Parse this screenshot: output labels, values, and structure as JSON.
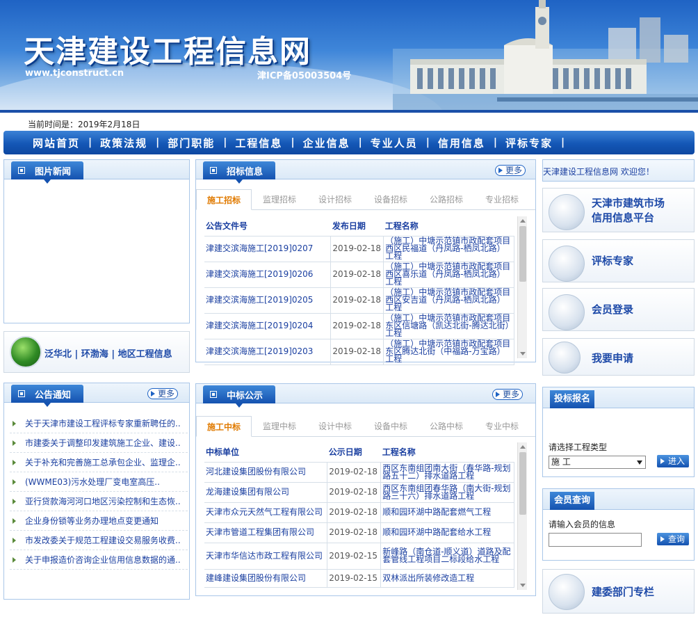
{
  "banner": {
    "title": "天津建设工程信息网",
    "url": "www.tjconstruct.cn",
    "icp": "津ICP备05003504号"
  },
  "date_line": "当前时间是：2019年2月18日",
  "nav": [
    "网站首页",
    "政策法规",
    "部门职能",
    "工程信息",
    "企业信息",
    "专业人员",
    "信用信息",
    "评标专家"
  ],
  "nav_sep": "|",
  "photo_news": {
    "title": "图片新闻"
  },
  "region_banner": "泛华北 | 环渤海 | 地区工程信息",
  "notices": {
    "title": "公告通知",
    "more": "更多",
    "items": [
      "关于天津市建设工程评标专家重新聘任的..",
      "市建委关于调整印发建筑施工企业、建设..",
      "关于补充和完善施工总承包企业、监理企..",
      "(WWME03)污水处理厂变电室高压..",
      "亚行贷款海河河口地区污染控制和生态恢..",
      "企业身份锁等业务办理地点变更通知",
      "市发改委关于规范工程建设交易服务收费..",
      "关于申报造价咨询企业信用信息数据的通.."
    ]
  },
  "bidding": {
    "title": "招标信息",
    "more": "更多",
    "tabs": [
      "施工招标",
      "监理招标",
      "设计招标",
      "设备招标",
      "公路招标",
      "专业招标"
    ],
    "headers": [
      "公告文件号",
      "发布日期",
      "工程名称"
    ],
    "rows": [
      [
        "津建交滨海施工[2019]0207",
        "2019-02-18",
        "（施工）中塘示范镇市政配套项目西区民福道（丹凤路-栖凤北路）工程"
      ],
      [
        "津建交滨海施工[2019]0206",
        "2019-02-18",
        "（施工）中塘示范镇市政配套项目西区喜乐道（丹凤路-栖凤北路）工程"
      ],
      [
        "津建交滨海施工[2019]0205",
        "2019-02-18",
        "（施工）中塘示范镇市政配套项目西区安吉道（丹凤路-栖凤北路）工程"
      ],
      [
        "津建交滨海施工[2019]0204",
        "2019-02-18",
        "（施工）中塘示范镇市政配套项目东区信塘路（凯达北街-腾达北街）工程"
      ],
      [
        "津建交滨海施工[2019]0203",
        "2019-02-18",
        "（施工）中塘示范镇市政配套项目东区腾达北街（中福路-万宝路）工程"
      ]
    ]
  },
  "award": {
    "title": "中标公示",
    "more": "更多",
    "tabs": [
      "施工中标",
      "监理中标",
      "设计中标",
      "设备中标",
      "公路中标",
      "专业中标"
    ],
    "headers": [
      "中标单位",
      "公示日期",
      "工程名称"
    ],
    "rows": [
      [
        "河北建设集团股份有限公司",
        "2019-02-18",
        "西区东南组团南大街（春华路-规划路五十二）排水道路工程"
      ],
      [
        "龙海建设集团有限公司",
        "2019-02-18",
        "西区东南组团春华路（南大街-规划路三十六）排水道路工程"
      ],
      [
        "天津市众元天然气工程有限公司",
        "2019-02-18",
        "顺和园环湖中路配套燃气工程"
      ],
      [
        "天津市管道工程集团有限公司",
        "2019-02-18",
        "顺和园环湖中路配套给水工程"
      ],
      [
        "天津市华信达市政工程有限公司",
        "2019-02-15",
        "新峰路（南仓道-顺义道）道路及配套管线工程项目二标段给水工程"
      ],
      [
        "建峰建设集团股份有限公司",
        "2019-02-15",
        "双林派出所装修改造工程"
      ]
    ]
  },
  "welcome": "天津建设工程信息网 欢迎您！",
  "tiles": [
    {
      "label": "天津市建筑市场\n信用信息平台",
      "icon": "building-credit-icon"
    },
    {
      "label": "评标专家",
      "icon": "expert-book-icon"
    },
    {
      "label": "会员登录",
      "icon": "members-icon"
    },
    {
      "label": "我要申请",
      "icon": "apply-pen-icon"
    }
  ],
  "bid_signup": {
    "title": "投标报名",
    "prompt": "请选择工程类型",
    "selected": "施  工",
    "button": "进入"
  },
  "member_query": {
    "title": "会员查询",
    "prompt": "请输入会员的信息",
    "value": "",
    "button": "查询"
  },
  "dept_column": "建委部门专栏",
  "colors": {
    "brand": "#1452b0",
    "link": "#1a3fa0",
    "active_tab": "#e07a00"
  }
}
